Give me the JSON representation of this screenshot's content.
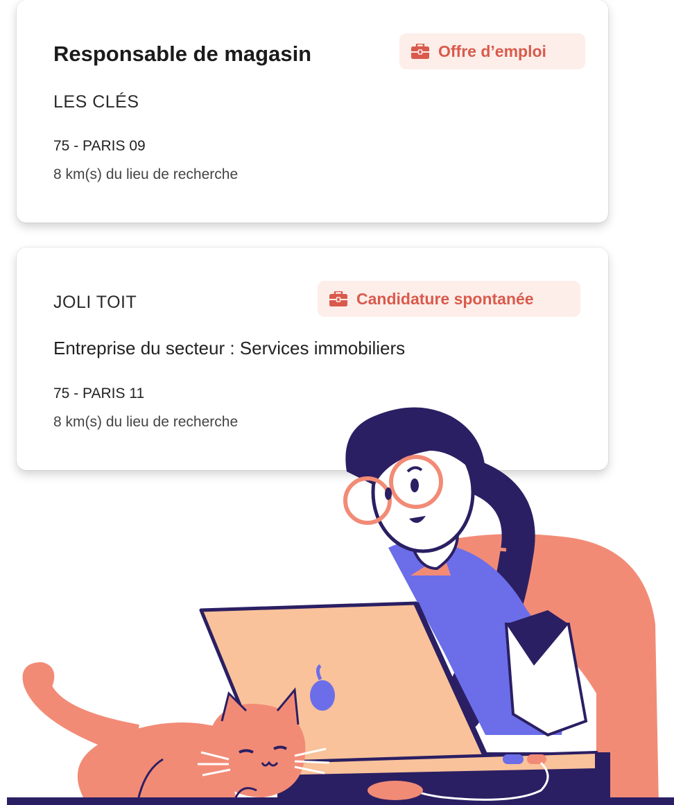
{
  "cards": [
    {
      "title": "Responsable de magasin",
      "badge": "Offre d’emploi",
      "company": "LES CLÉS",
      "location": "75 - PARIS 09",
      "distance": "8 km(s) du lieu de recherche"
    },
    {
      "company": "JOLI TOIT",
      "badge": "Candidature spontanée",
      "sector": "Entreprise du secteur : Services immobiliers",
      "location": "75 - PARIS 11",
      "distance": "8 km(s) du lieu de recherche"
    }
  ],
  "icons": {
    "badge": "briefcase-icon"
  },
  "colors": {
    "badge_text": "#d95a4c",
    "badge_bg": "#fdeeea",
    "illustration_navy": "#2b1f63",
    "illustration_coral": "#f28b76",
    "illustration_purple": "#6b6ee8",
    "illustration_peach": "#f9c29a"
  }
}
